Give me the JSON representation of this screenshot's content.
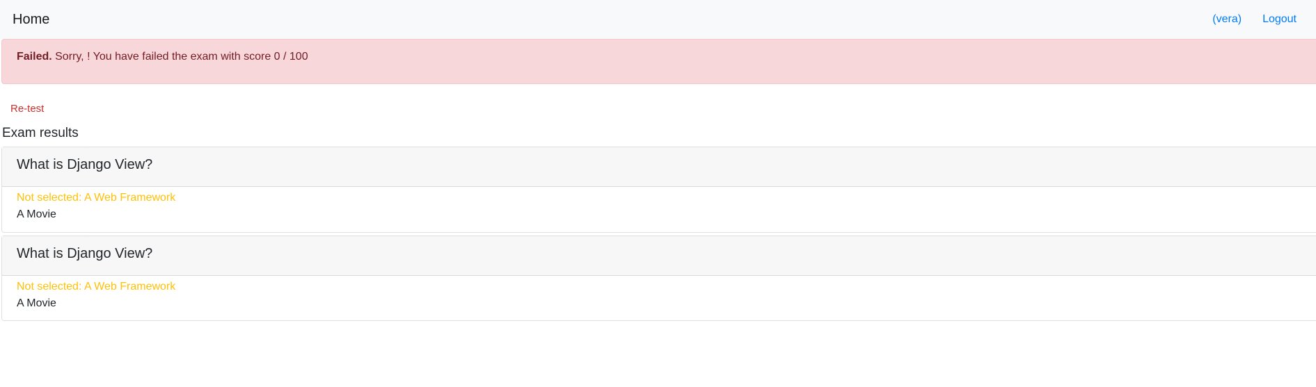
{
  "nav": {
    "brand": "Home",
    "user": "(vera)",
    "logout": "Logout"
  },
  "alert": {
    "strong": "Failed.",
    "message": " Sorry, ! You have failed the exam with score 0 / 100"
  },
  "retest_label": "Re-test",
  "section_title": "Exam results",
  "results": [
    {
      "question": "What is Django View?",
      "not_selected": "Not selected: A Web Framework",
      "answer": "A Movie"
    },
    {
      "question": "What is Django View?",
      "not_selected": "Not selected: A Web Framework",
      "answer": "A Movie"
    }
  ],
  "colors": {
    "alert_bg": "#f8d7da",
    "alert_text": "#721c24",
    "link": "#007bff",
    "not_selected": "#ffc107",
    "retest": "#c9302c"
  }
}
